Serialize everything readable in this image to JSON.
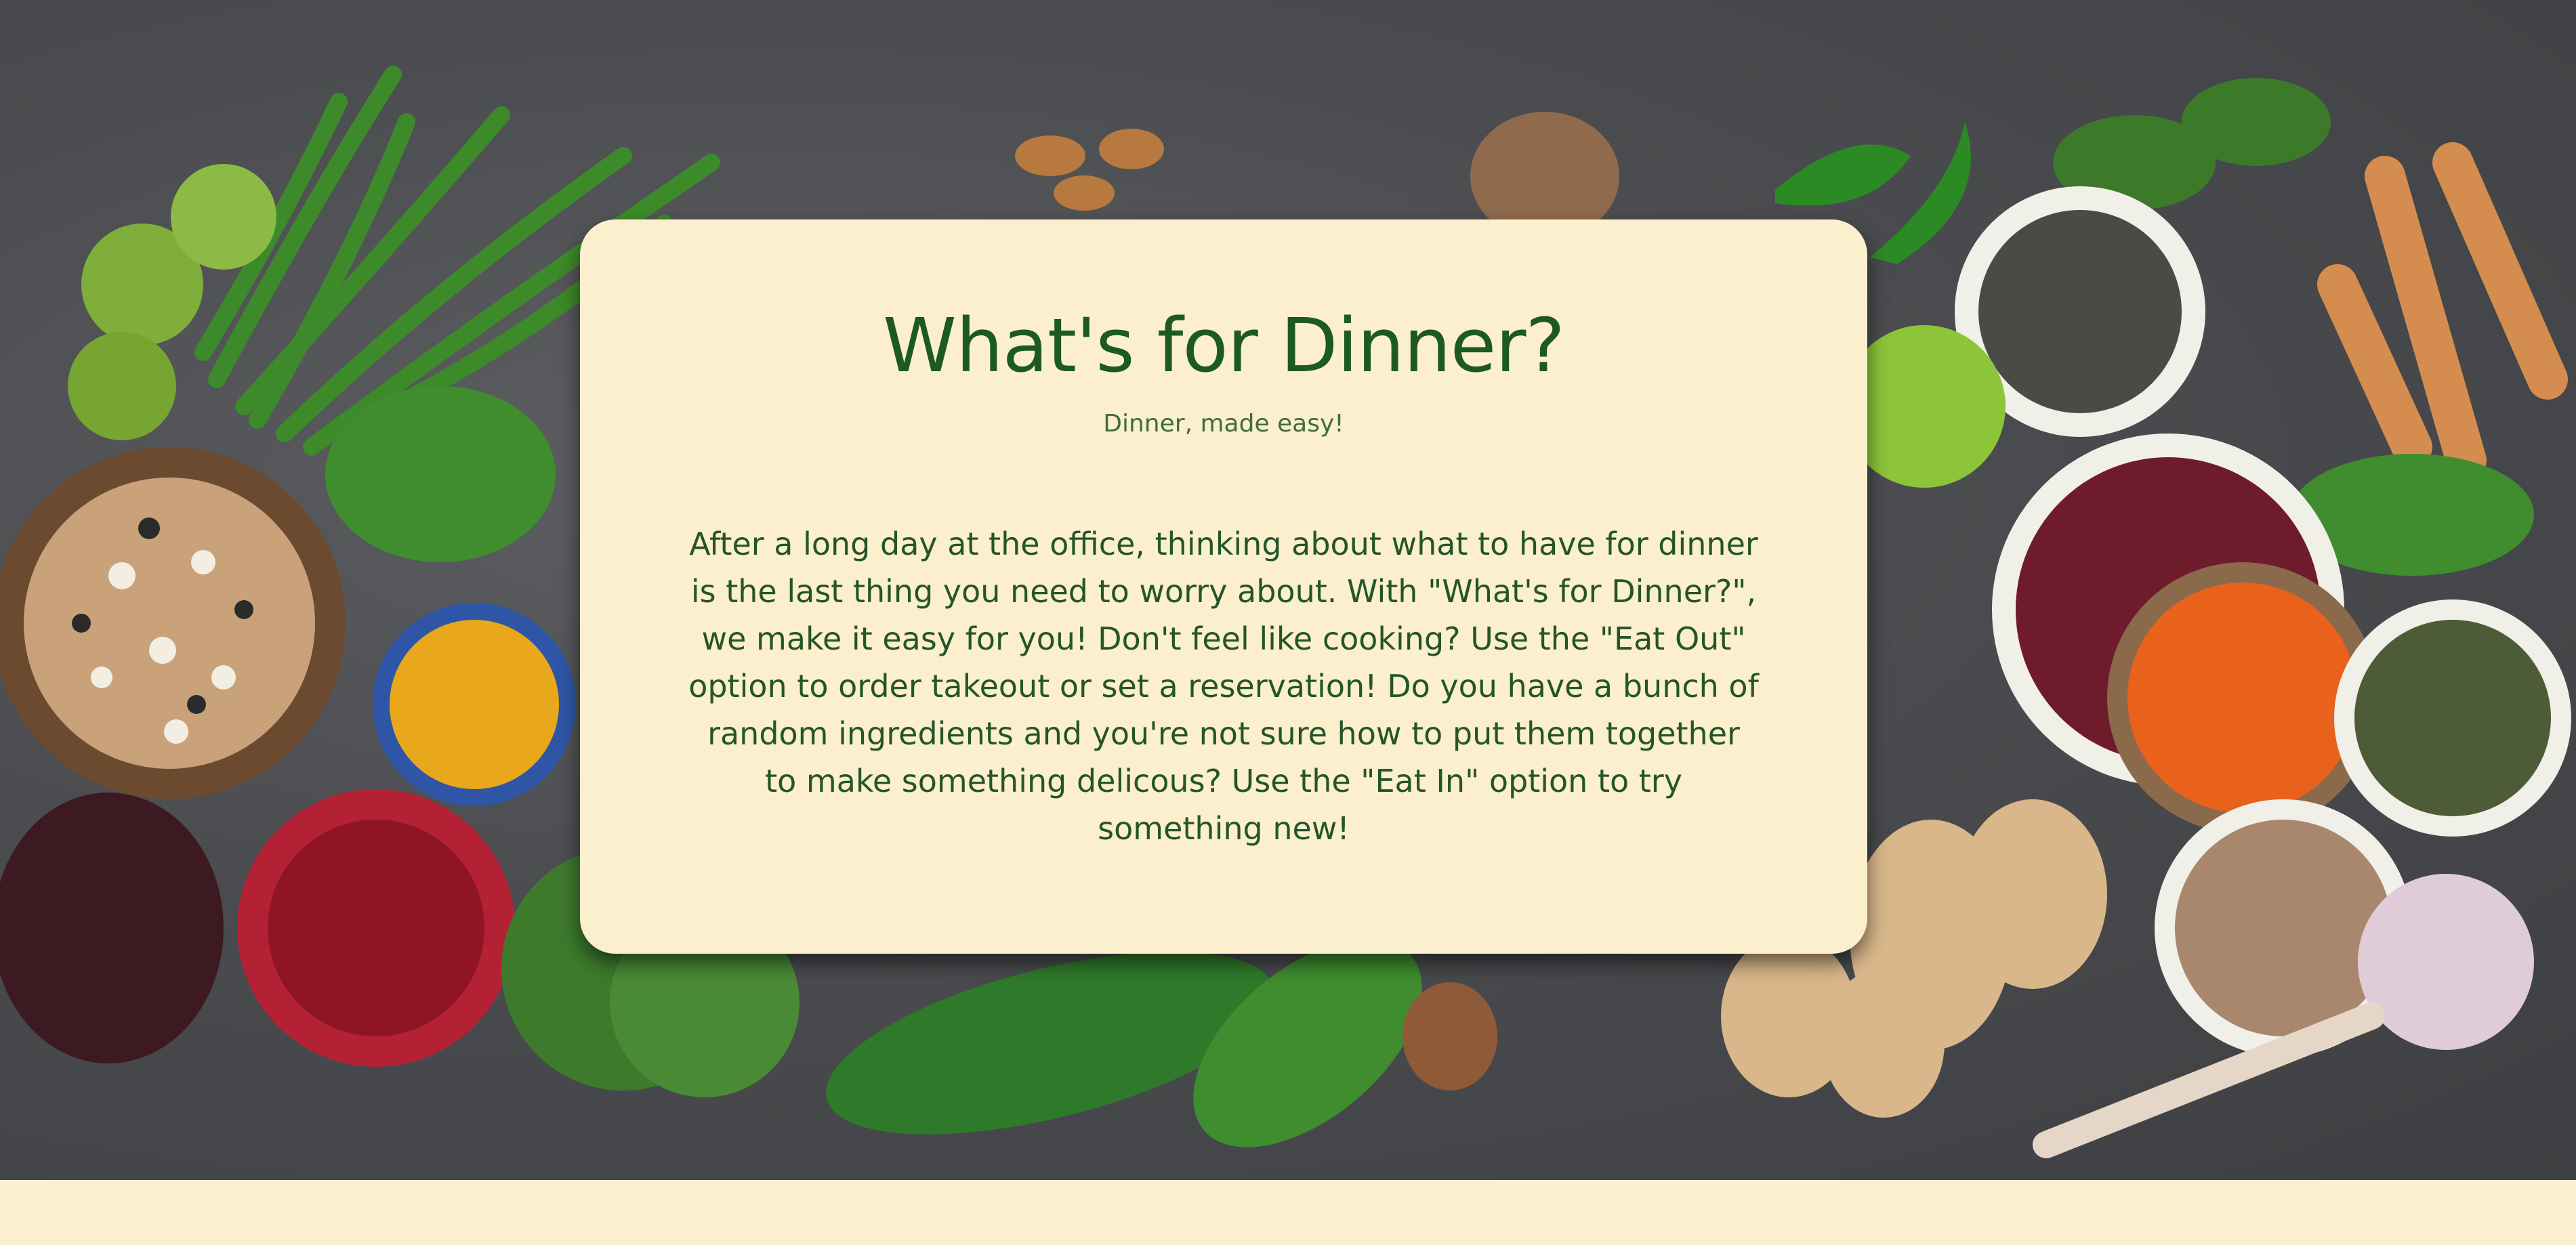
{
  "hero": {
    "background_image": "vegetables-and-legumes-flatlay"
  },
  "card": {
    "title": "What's for Dinner?",
    "subtitle": "Dinner, made easy!",
    "body": "After a long day at the office, thinking about what to have for dinner is the last thing you need to worry about. With \"What's for Dinner?\", we make it easy for you! Don't feel like cooking? Use the \"Eat Out\" option to order takeout or set a reservation! Do you have a bunch of random ingredients and you're not sure how to put them together to make something delicous? Use the \"Eat In\" option to try something new!"
  },
  "colors": {
    "card_background": "#fbefcd",
    "title_green": "#1d5a22",
    "page_background": "#fbf0cd"
  }
}
